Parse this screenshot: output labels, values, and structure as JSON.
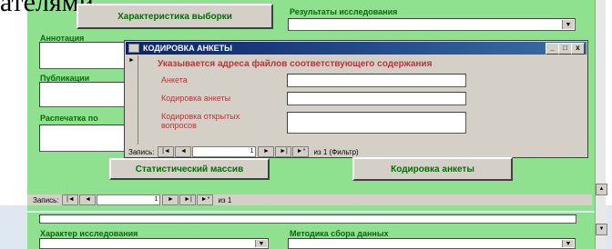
{
  "heading": "ателями",
  "form": {
    "sample_button": "Характеристика выборки",
    "results_label": "Результаты исследования",
    "annotation_label": "Аннотация",
    "publications_label": "Публикации",
    "printout_label": "Распечатка по",
    "stat_array_button": "Статистический массив",
    "coding_button": "Кодировка анкеты",
    "research_type_label": "Характер исследования",
    "method_label": "Методика сбора данных",
    "nav": {
      "label": "Запись:",
      "first": "|◄",
      "prev": "◄",
      "current": "1",
      "next": "►",
      "last": "►|",
      "new": "►*",
      "of_text": "из 1"
    }
  },
  "dialog": {
    "title": "КОДИРОВКА АНКЕТЫ",
    "record_marker": "►",
    "instruction": "Указывается адреса файлов соответствующего содержания",
    "fields": [
      {
        "label": "Анкета",
        "value": ""
      },
      {
        "label": "Кодировка анкеты",
        "value": ""
      },
      {
        "label": "Кодировка открытых вопросов",
        "value": ""
      }
    ],
    "nav": {
      "label": "Запись:",
      "first": "|◄",
      "prev": "◄",
      "current": "1",
      "next": "►",
      "last": "►|",
      "new": "►*",
      "of_text": "из 1 (Фильтр)"
    },
    "controls": {
      "minimize": "_",
      "maximize": "□",
      "close": "x"
    }
  },
  "colors": {
    "form_green": "#8fe08f",
    "label_green": "#0a6a0a",
    "dialog_label_red": "#b03a3a",
    "titlebar_blue": "#0a246a"
  }
}
